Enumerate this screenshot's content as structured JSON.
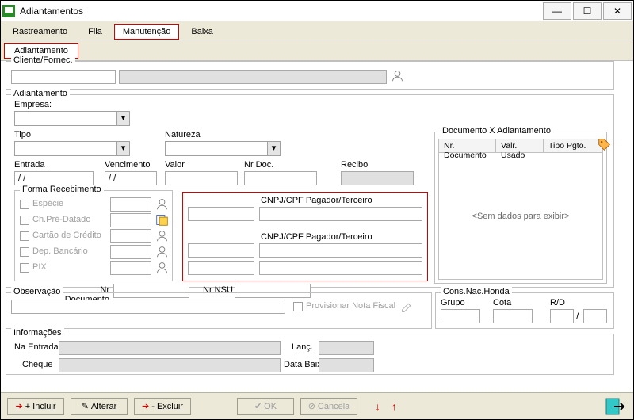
{
  "window": {
    "title": "Adiantamentos"
  },
  "tabs": [
    "Rastreamento",
    "Fila",
    "Manutenção",
    "Baixa"
  ],
  "subtab": "Adiantamento",
  "cliente": {
    "legend": "Cliente/Fornec."
  },
  "adiant": {
    "legend": "Adiantamento",
    "labels": {
      "empresa": "Empresa:",
      "tipo": "Tipo",
      "natureza": "Natureza",
      "entrada": "Entrada",
      "venc": "Vencimento",
      "valor": "Valor",
      "nrdoc": "Nr Doc.",
      "recibo": "Recibo"
    },
    "values": {
      "entrada": "/  /",
      "venc": "/  /"
    }
  },
  "forma": {
    "legend": "Forma Recebimento",
    "items": [
      "Espécie",
      "Ch.Pré-Datado",
      "Cartão de Crédito",
      "Dep. Bancário",
      "PIX"
    ],
    "nrdoc": "Nr Documento",
    "nrnsu": "Nr NSU"
  },
  "cnpj": {
    "title1": "CNPJ/CPF Pagador/Terceiro",
    "title2": "CNPJ/CPF Pagador/Terceiro"
  },
  "docx": {
    "legend": "Documento X Adiantamento",
    "cols": [
      "Nr. Documento",
      "Valr. Usado",
      "Tipo Pgto."
    ],
    "empty": "<Sem dados para exibir>"
  },
  "obs": {
    "legend": "Observação",
    "prov": "Provisionar Nota Fiscal"
  },
  "cons": {
    "legend": "Cons.Nac.Honda",
    "grupo": "Grupo",
    "cota": "Cota",
    "rd": "R/D"
  },
  "info": {
    "legend": "Informações",
    "naentrada": "Na Entrada",
    "lanc": "Lanç.",
    "cheque": "Cheque",
    "databaixa": "Data Baixa"
  },
  "buttons": {
    "incluir": "Incluir",
    "alterar": "Alterar",
    "excluir": "Excluir",
    "ok": "OK",
    "cancela": "Cancela"
  }
}
